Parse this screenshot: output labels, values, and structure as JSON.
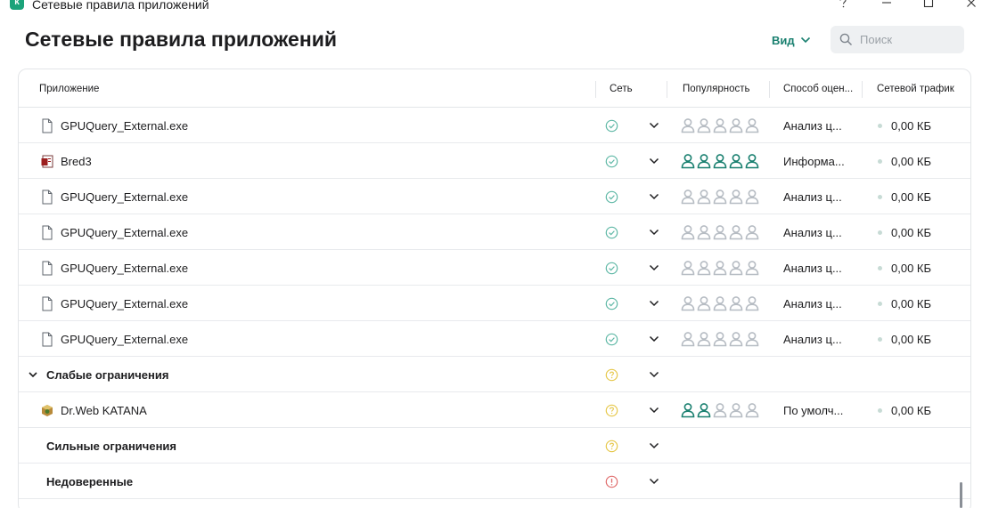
{
  "window": {
    "title": "Сетевые правила приложений",
    "logo_letter": "k",
    "controls": [
      "help-icon",
      "minimize-icon",
      "maximize-icon",
      "close-icon"
    ]
  },
  "header": {
    "title": "Сетевые правила приложений",
    "view_label": "Вид",
    "search_placeholder": "Поиск"
  },
  "columns": {
    "app": "Приложение",
    "network": "Сеть",
    "popularity": "Популярность",
    "method": "Способ оцен...",
    "traffic": "Сетевой трафик"
  },
  "colors": {
    "accent": "#1a8070",
    "status_ok": "#5fb8a6",
    "status_warn": "#e6c84c",
    "status_danger": "#e06b6b",
    "person_active": "#1a8070",
    "person_inactive": "#b6bcc3"
  },
  "rows": [
    {
      "type": "app",
      "icon": "file-icon",
      "name": "GPUQuery_External.exe",
      "status": "ok",
      "popularity": 0,
      "method": "Анализ ц...",
      "traffic": "0,00 КБ"
    },
    {
      "type": "app",
      "icon": "bred-app-icon",
      "name": "Bred3",
      "status": "ok",
      "popularity": 5,
      "method": "Информа...",
      "traffic": "0,00 КБ"
    },
    {
      "type": "app",
      "icon": "file-icon",
      "name": "GPUQuery_External.exe",
      "status": "ok",
      "popularity": 0,
      "method": "Анализ ц...",
      "traffic": "0,00 КБ"
    },
    {
      "type": "app",
      "icon": "file-icon",
      "name": "GPUQuery_External.exe",
      "status": "ok",
      "popularity": 0,
      "method": "Анализ ц...",
      "traffic": "0,00 КБ"
    },
    {
      "type": "app",
      "icon": "file-icon",
      "name": "GPUQuery_External.exe",
      "status": "ok",
      "popularity": 0,
      "method": "Анализ ц...",
      "traffic": "0,00 КБ"
    },
    {
      "type": "app",
      "icon": "file-icon",
      "name": "GPUQuery_External.exe",
      "status": "ok",
      "popularity": 0,
      "method": "Анализ ц...",
      "traffic": "0,00 КБ"
    },
    {
      "type": "app",
      "icon": "file-icon",
      "name": "GPUQuery_External.exe",
      "status": "ok",
      "popularity": 0,
      "method": "Анализ ц...",
      "traffic": "0,00 КБ"
    },
    {
      "type": "group",
      "name": "Слабые ограничения",
      "expanded": true,
      "status": "warn"
    },
    {
      "type": "app",
      "icon": "drweb-app-icon",
      "name": "Dr.Web KATANA",
      "status": "warn",
      "popularity": 2,
      "method": "По умолч...",
      "traffic": "0,00 КБ"
    },
    {
      "type": "group",
      "name": "Сильные ограничения",
      "expanded": false,
      "status": "warn"
    },
    {
      "type": "group",
      "name": "Недоверенные",
      "expanded": false,
      "status": "danger"
    }
  ]
}
